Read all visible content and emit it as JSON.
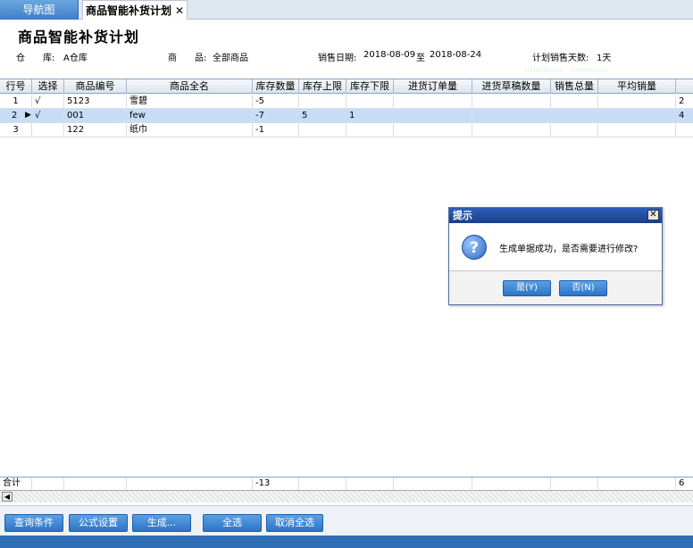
{
  "tabs": {
    "nav_label": "导航图",
    "active_label": "商品智能补货计划",
    "close_glyph": "✕"
  },
  "header": {
    "title": "商品智能补货计划",
    "warehouse_label": "仓　　库:",
    "warehouse_value": "A仓库",
    "goods_label": "商　　品:",
    "goods_value": "全部商品",
    "sales_date_label": "销售日期:",
    "sales_date_from": "2018-08-09",
    "sales_date_to_word": "至",
    "sales_date_to": "2018-08-24",
    "plan_days_label": "计划销售天数:",
    "plan_days_value": "1天"
  },
  "table": {
    "columns": [
      "行号",
      "选择",
      "商品编号",
      "商品全名",
      "库存数量",
      "库存上限",
      "库存下限",
      "进货订单量",
      "进货草稿数量",
      "销售总量",
      "平均销量"
    ],
    "rows": [
      {
        "line": "1",
        "check": "√",
        "code": "5123",
        "name": "雪碧",
        "stock": "-5",
        "upper": "",
        "lower": "",
        "order_qty": "",
        "draft_qty": "",
        "sales_total": "",
        "avg_sales": "",
        "extra": "2"
      },
      {
        "line": "2",
        "check": "√",
        "code": "001",
        "name": "few",
        "stock": "-7",
        "upper": "5",
        "lower": "1",
        "order_qty": "",
        "draft_qty": "",
        "sales_total": "",
        "avg_sales": "",
        "extra": "4"
      },
      {
        "line": "3",
        "check": "",
        "code": "122",
        "name": "纸巾",
        "stock": "-1",
        "upper": "",
        "lower": "",
        "order_qty": "",
        "draft_qty": "",
        "sales_total": "",
        "avg_sales": "",
        "extra": ""
      }
    ],
    "selected_row_marker": "▶",
    "sum_label": "合计",
    "sum_stock": "-13",
    "sum_extra": "6"
  },
  "toolbar": {
    "query_label": "查询条件",
    "formula_label": "公式设置",
    "generate_label": "生成...",
    "select_all_label": "全选",
    "deselect_all_label": "取消全选"
  },
  "dialog": {
    "title": "提示",
    "close_glyph": "✕",
    "icon_glyph": "?",
    "message": "生成单据成功，是否需要进行修改?",
    "yes_label": "是(Y)",
    "no_label": "否(N)"
  },
  "colors": {
    "accent": "#2d74c6",
    "selected_row": "#c7ddf6",
    "dialog_title": "#1a3f8a"
  }
}
